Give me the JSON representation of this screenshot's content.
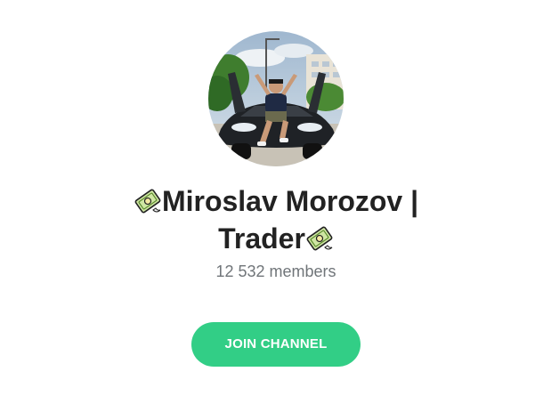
{
  "channel": {
    "title_part1": "Miroslav Morozov |",
    "title_part2": "Trader",
    "leading_icon": "money-with-wings-icon",
    "trailing_icon": "money-with-wings-icon",
    "members": "12 532 members",
    "avatar_icon": "avatar"
  },
  "actions": {
    "join_label": "JOIN CHANNEL"
  },
  "colors": {
    "button": "#32ce86",
    "title": "#222222",
    "members": "#707579"
  }
}
